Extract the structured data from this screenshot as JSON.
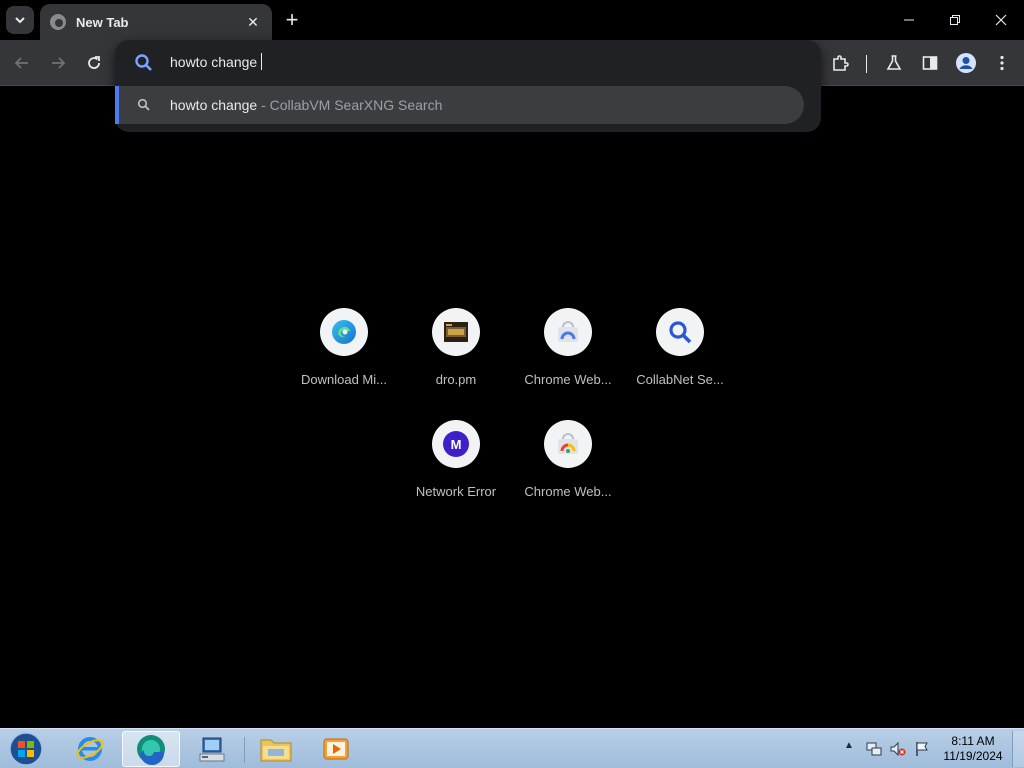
{
  "browser": {
    "tab": {
      "title": "New Tab"
    },
    "window_controls": {
      "minimize": "—",
      "restore": "❐",
      "close": "✕"
    },
    "new_tab_glyph": "+"
  },
  "omnibox": {
    "value": "howto change",
    "suggestion": {
      "query": "howto change",
      "separator": " - ",
      "source": "CollabVM SearXNG Search"
    }
  },
  "shortcuts": [
    {
      "label": "Download Mi...",
      "icon": "edge-icon"
    },
    {
      "label": "dro.pm",
      "icon": "dropm-icon"
    },
    {
      "label": "Chrome Web...",
      "icon": "chrome-web-store-icon"
    },
    {
      "label": "CollabNet Se...",
      "icon": "search-icon"
    },
    {
      "label": "Network Error",
      "icon": "m-letter-icon",
      "letter": "M"
    },
    {
      "label": "Chrome Web...",
      "icon": "chrome-web-store-icon"
    }
  ],
  "taskbar": {
    "clock_time": "8:11 AM",
    "clock_date": "11/19/2024"
  },
  "colors": {
    "accent": "#4d7bf0",
    "m_badge": "#3f1fc7"
  }
}
